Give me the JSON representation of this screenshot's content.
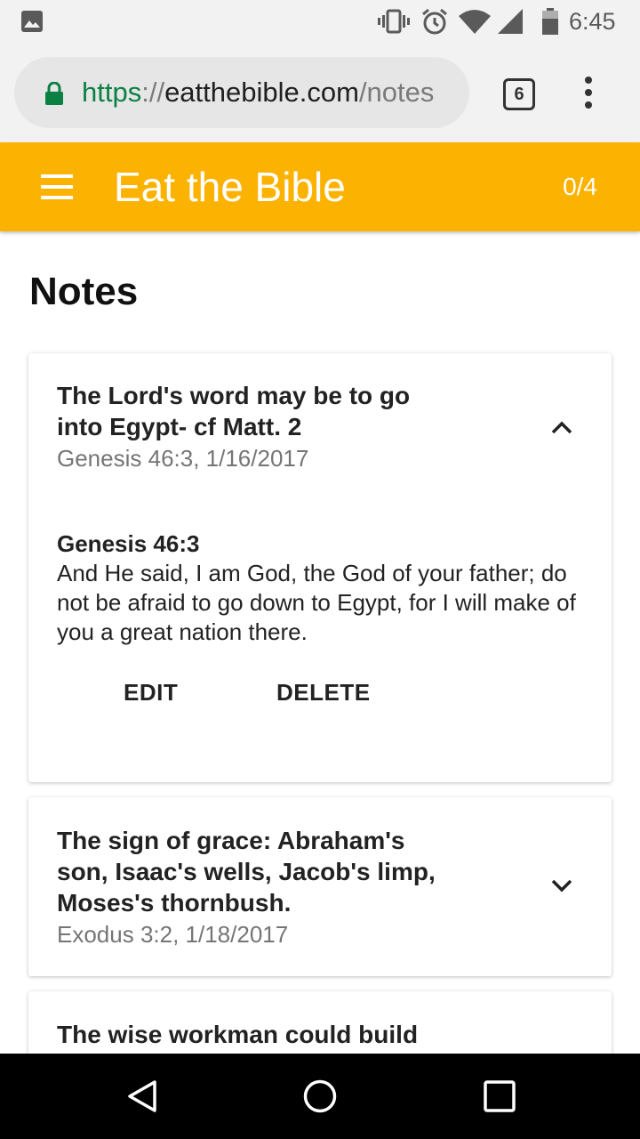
{
  "status_bar": {
    "time": "6:45",
    "icons": [
      "image-notification-icon",
      "vibrate-icon",
      "alarm-icon",
      "wifi-icon",
      "signal-icon",
      "battery-icon"
    ]
  },
  "browser": {
    "url_scheme": "https",
    "url_separator": "://",
    "url_host": "eatthebible.com",
    "url_path": "/notes",
    "tab_count": "6"
  },
  "app_bar": {
    "title": "Eat the Bible",
    "count": "0/4",
    "color": "#fbb200"
  },
  "page": {
    "title": "Notes"
  },
  "notes": [
    {
      "title": "The Lord's word may be to go into Egypt- cf Matt. 2",
      "meta": "Genesis 46:3, 1/16/2017",
      "expanded": true,
      "verse_ref": "Genesis 46:3",
      "verse_text": "And He said, I am God, the God of your father; do not be afraid to go down to Egypt, for I will make of you a great nation there.",
      "edit_label": "EDIT",
      "delete_label": "DELETE"
    },
    {
      "title": "The sign of grace: Abraham's son, Isaac's wells, Jacob's limp, Moses's thornbush.",
      "meta": "Exodus 3:2, 1/18/2017",
      "expanded": false
    },
    {
      "title": "The wise workman could build"
    }
  ],
  "nav_bar": {
    "icons": [
      "back-icon",
      "home-icon",
      "recents-icon"
    ]
  }
}
